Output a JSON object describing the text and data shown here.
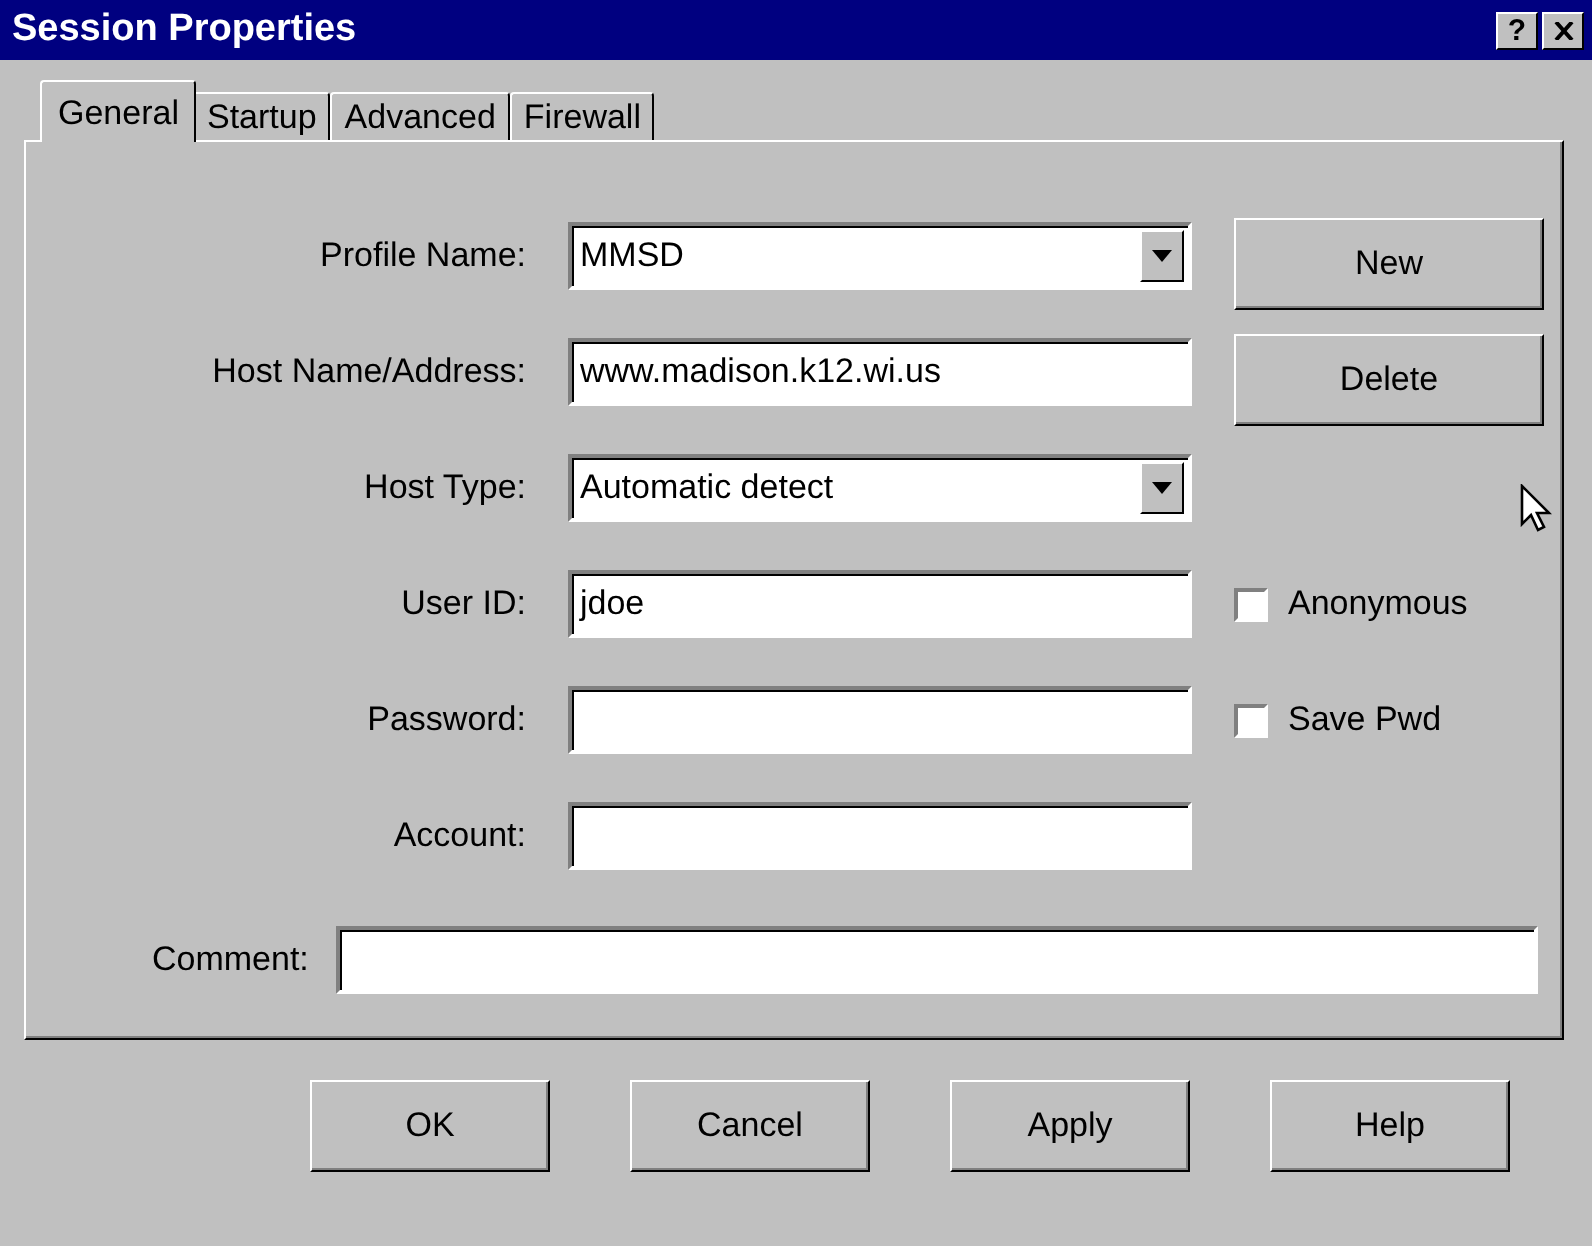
{
  "window": {
    "title": "Session Properties",
    "help_button": "?"
  },
  "tabs": [
    {
      "label": "General",
      "selected": true
    },
    {
      "label": "Startup",
      "selected": false
    },
    {
      "label": "Advanced",
      "selected": false
    },
    {
      "label": "Firewall",
      "selected": false
    }
  ],
  "fields": [
    {
      "kind": "dropdown",
      "label": "Profile Name:",
      "value": "MMSD",
      "side": {
        "kind": "button",
        "label": "New"
      }
    },
    {
      "kind": "text",
      "label": "Host Name/Address:",
      "value": "www.madison.k12.wi.us",
      "side": {
        "kind": "button",
        "label": "Delete"
      }
    },
    {
      "kind": "dropdown",
      "label": "Host Type:",
      "value": "Automatic detect"
    },
    {
      "kind": "text",
      "label": "User ID:",
      "value": "jdoe",
      "side": {
        "kind": "checkbox",
        "label": "Anonymous",
        "checked": false
      }
    },
    {
      "kind": "text",
      "label": "Password:",
      "side": {
        "kind": "checkbox",
        "label": "Save Pwd",
        "checked": false
      }
    },
    {
      "kind": "text",
      "label": "Account:"
    }
  ],
  "comment": {
    "label": "Comment:"
  },
  "buttons": [
    "OK",
    "Cancel",
    "Apply",
    "Help"
  ]
}
